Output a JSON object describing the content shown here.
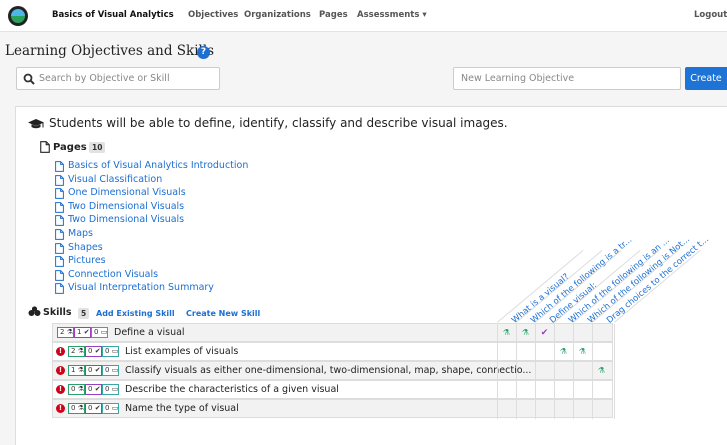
{
  "navbar": {
    "brand": "Basics of Visual Analytics",
    "items": [
      {
        "label": "Objectives"
      },
      {
        "label": "Organizations"
      },
      {
        "label": "Pages"
      },
      {
        "label": "Assessments ▾"
      }
    ],
    "logout": "Logout"
  },
  "header": {
    "title": "Learning Objectives and Skills",
    "search_placeholder": "Search by Objective or Skill",
    "new_objective_placeholder": "New Learning Objective",
    "create_label": "Create"
  },
  "objective": {
    "text": "Students will be able to define, identify, classify and describe visual images.",
    "pages_label": "Pages",
    "pages_count": "10",
    "pages": [
      "Basics of Visual Analytics Introduction",
      "Visual Classification",
      "One Dimensional Visuals",
      "Two Dimensional Visuals",
      "Two Dimensional Visuals",
      "Maps",
      "Shapes",
      "Pictures",
      "Connection Visuals",
      "Visual Interpretation Summary"
    ],
    "skills_label": "Skills",
    "skills_count": "5",
    "add_existing_label": "Add Existing Skill",
    "create_new_label": "Create New Skill",
    "question_headers": [
      "What is a visual?",
      "Which of the following is a tr...",
      "Define visual:",
      "Which of the following is an ...",
      "Which of the following is Not...",
      "Drag choices to the correct t..."
    ],
    "skills": [
      {
        "warning": false,
        "c1": "2",
        "c2": "1",
        "c3": "0",
        "label": "Define a visual",
        "marks": [
          "flask",
          "flask",
          "check",
          "",
          "",
          ""
        ]
      },
      {
        "warning": true,
        "c1": "2",
        "c2": "0",
        "c3": "0",
        "label": "List examples of visuals",
        "marks": [
          "",
          "",
          "",
          "flask",
          "flask",
          ""
        ]
      },
      {
        "warning": true,
        "c1": "1",
        "c2": "0",
        "c3": "0",
        "label": "Classify visuals as either one-dimensional, two-dimensional, map, shape, connectio...",
        "marks": [
          "",
          "",
          "",
          "",
          "",
          "flask"
        ]
      },
      {
        "warning": true,
        "c1": "0",
        "c2": "0",
        "c3": "0",
        "label": "Describe the characteristics of a given visual",
        "marks": [
          "",
          "",
          "",
          "",
          "",
          ""
        ]
      },
      {
        "warning": true,
        "c1": "0",
        "c2": "0",
        "c3": "0",
        "label": "Name the type of visual",
        "marks": [
          "",
          "",
          "",
          "",
          "",
          ""
        ]
      }
    ]
  }
}
